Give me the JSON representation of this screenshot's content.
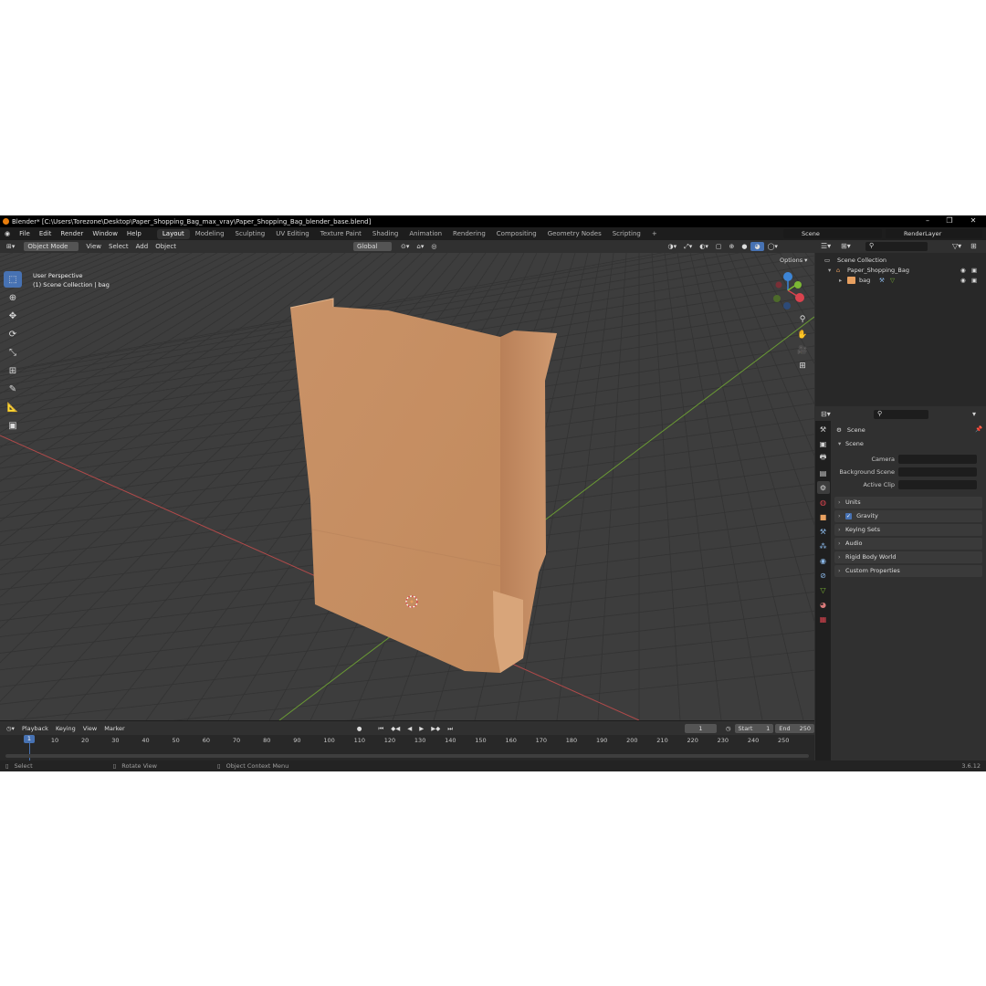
{
  "titlebar": {
    "title": "Blender* [C:\\Users\\Torezone\\Desktop\\Paper_Shopping_Bag_max_vray\\Paper_Shopping_Bag_blender_base.blend]"
  },
  "menubar": {
    "menus": [
      "File",
      "Edit",
      "Render",
      "Window",
      "Help"
    ],
    "workspaces": [
      "Layout",
      "Modeling",
      "Sculpting",
      "UV Editing",
      "Texture Paint",
      "Shading",
      "Animation",
      "Rendering",
      "Compositing",
      "Geometry Nodes",
      "Scripting"
    ],
    "active_workspace": "Layout",
    "add_tab": "+",
    "scene": "Scene",
    "view_layer": "RenderLayer"
  },
  "viewport_header": {
    "mode": "Object Mode",
    "menus": [
      "View",
      "Select",
      "Add",
      "Object"
    ],
    "orientation": "Global",
    "options": "Options"
  },
  "viewport": {
    "perspective": "User Perspective",
    "collection_info": "(1) Scene Collection | bag",
    "axes": {
      "x": "X",
      "y": "Y",
      "z": "Z"
    }
  },
  "timeline": {
    "menus": [
      "Playback",
      "Keying",
      "View",
      "Marker"
    ],
    "current_frame": "1",
    "start_label": "Start",
    "start": "1",
    "end_label": "End",
    "end": "250",
    "ticks": [
      "1",
      "10",
      "20",
      "30",
      "40",
      "50",
      "60",
      "70",
      "80",
      "90",
      "100",
      "110",
      "120",
      "130",
      "140",
      "150",
      "160",
      "170",
      "180",
      "190",
      "200",
      "210",
      "220",
      "230",
      "240",
      "250"
    ]
  },
  "outliner": {
    "root": "Scene Collection",
    "collection": "Paper_Shopping_Bag",
    "object": "bag"
  },
  "properties": {
    "context": "Scene",
    "panel_scene": "Scene",
    "fields": [
      {
        "label": "Camera"
      },
      {
        "label": "Background Scene"
      },
      {
        "label": "Active Clip"
      }
    ],
    "panels": [
      "Units",
      "Gravity",
      "Keying Sets",
      "Audio",
      "Rigid Body World",
      "Custom Properties"
    ]
  },
  "statusbar": {
    "items": [
      "Select",
      "Rotate View",
      "Object Context Menu"
    ],
    "version": "3.6.12"
  },
  "colors": {
    "accent": "#4772b3",
    "bag": "#c98f63",
    "x_axis": "#d9434e",
    "y_axis": "#7cb834",
    "z_axis": "#3d85d6"
  }
}
